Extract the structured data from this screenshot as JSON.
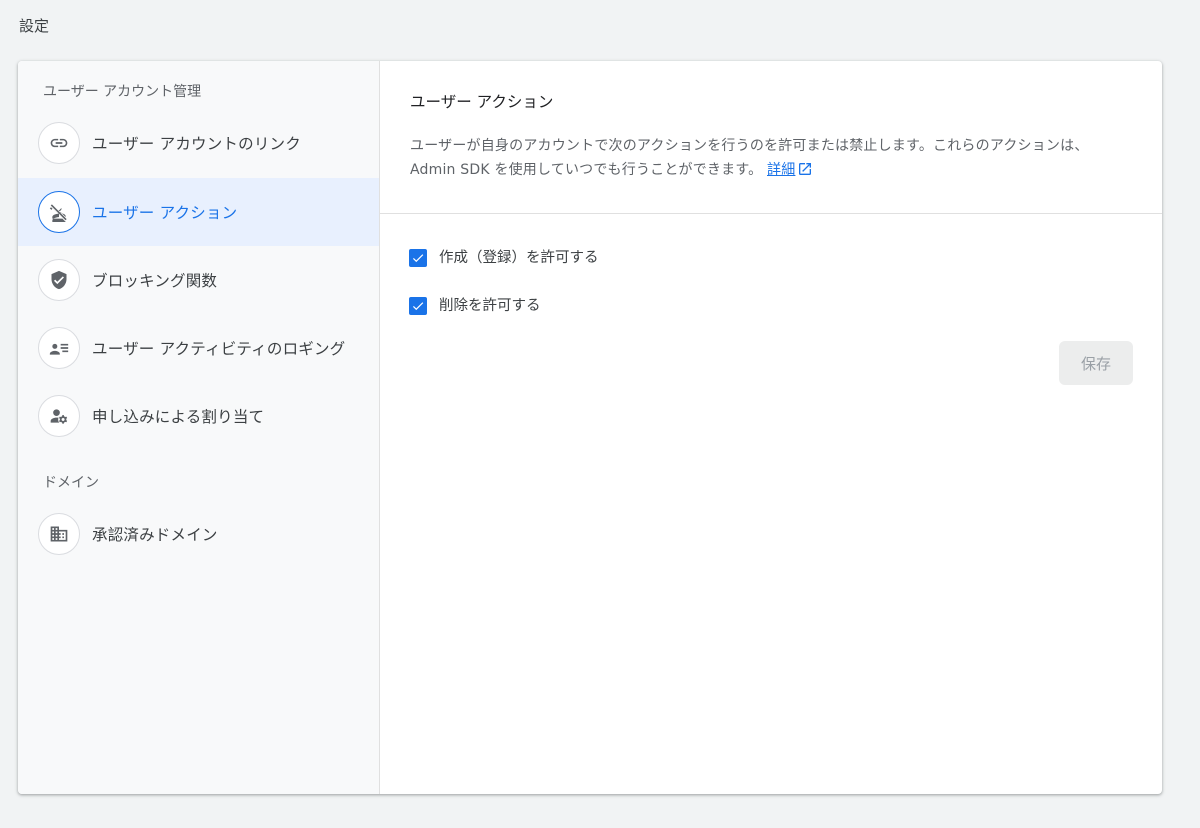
{
  "page": {
    "title": "設定"
  },
  "sidebar": {
    "sections": [
      {
        "header": "ユーザー アカウント管理",
        "items": [
          {
            "label": "ユーザー アカウントのリンク",
            "icon": "link-icon"
          },
          {
            "label": "ユーザー アクション",
            "icon": "person-off-icon",
            "active": true
          },
          {
            "label": "ブロッキング関数",
            "icon": "shield-check-icon"
          },
          {
            "label": "ユーザー アクティビティのロギング",
            "icon": "person-list-icon"
          },
          {
            "label": "申し込みによる割り当て",
            "icon": "person-gear-icon"
          }
        ]
      },
      {
        "header": "ドメイン",
        "items": [
          {
            "label": "承認済みドメイン",
            "icon": "building-icon"
          }
        ]
      }
    ]
  },
  "main": {
    "title": "ユーザー アクション",
    "description": "ユーザーが自身のアカウントで次のアクションを行うのを許可または禁止します。これらのアクションは、Admin SDK を使用していつでも行うことができます。",
    "learn_more": "詳細",
    "checkboxes": [
      {
        "label": "作成（登録）を許可する",
        "checked": true
      },
      {
        "label": "削除を許可する",
        "checked": true
      }
    ],
    "save_label": "保存"
  },
  "colors": {
    "accent": "#1a73e8",
    "active_background": "#e8f0fe",
    "page_background": "#f1f3f4"
  }
}
